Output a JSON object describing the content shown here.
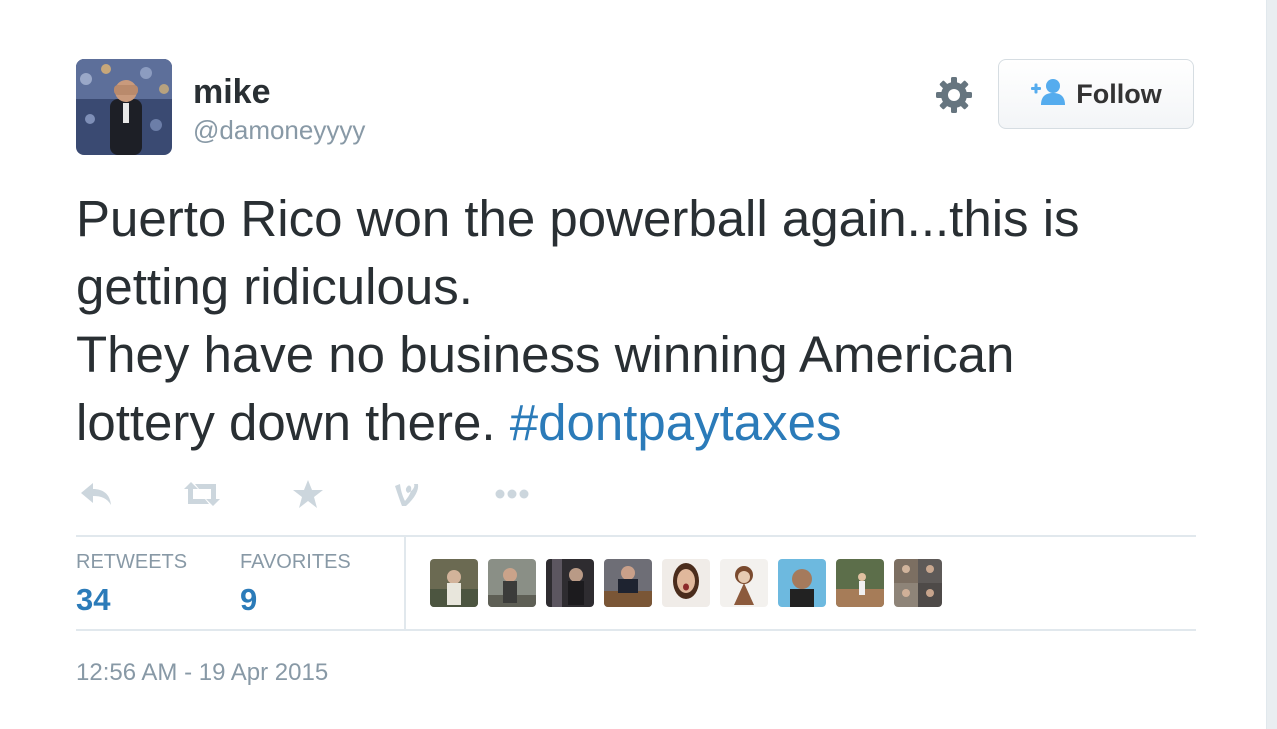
{
  "tweet": {
    "user": {
      "name": "mike",
      "handle": "@damoneyyyy"
    },
    "follow_label": "Follow",
    "text_lines": [
      "Puerto Rico won the powerball again...this is",
      "getting ridiculous.",
      "They have no business winning American",
      "lottery down there. "
    ],
    "hashtag": "#dontpaytaxes",
    "stats": {
      "retweets": {
        "label": "RETWEETS",
        "value": "34"
      },
      "favorites": {
        "label": "FAVORITES",
        "value": "9"
      }
    },
    "timestamp": "12:56 AM - 19 Apr 2015"
  },
  "icons": {
    "settings": "gear-icon",
    "follow": "add-user-icon",
    "actions": [
      "reply-icon",
      "retweet-icon",
      "favorite-icon",
      "vine-icon",
      "more-icon"
    ]
  },
  "colors": {
    "link": "#2b7bb9",
    "muted": "#8899a6",
    "text": "#292f33",
    "follow_icon": "#55acee"
  }
}
